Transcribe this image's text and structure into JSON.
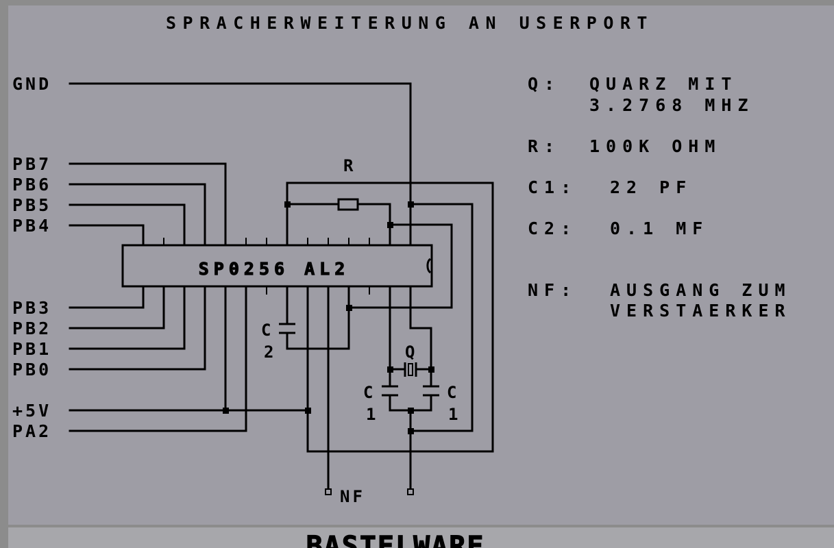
{
  "title": "SPRACHERWEITERUNG AN USERPORT",
  "chip_label": "SP0256 AL2",
  "pins_left": [
    "GND",
    "PB7",
    "PB6",
    "PB5",
    "PB4",
    "PB3",
    "PB2",
    "PB1",
    "PB0",
    "+5V",
    "PA2"
  ],
  "component_labels": {
    "resistor": "R",
    "cap_c2_letter": "C",
    "cap_c2_digit": "2",
    "crystal": "Q",
    "cap_c1_left_letter": "C",
    "cap_c1_left_digit": "1",
    "cap_c1_right_letter": "C",
    "cap_c1_right_digit": "1",
    "output": "NF"
  },
  "legend": {
    "q_key": "Q:",
    "q_line1": "QUARZ MIT",
    "q_line2": "3.2768 MHZ",
    "r_key": "R:",
    "r_value": "100K OHM",
    "c1_key": "C1:",
    "c1_value": "22 PF",
    "c2_key": "C2:",
    "c2_value": "0.1 MF",
    "nf_key": "NF:",
    "nf_line1": "AUSGANG ZUM",
    "nf_line2": "VERSTAERKER"
  },
  "footer": "BASTELWARE",
  "colors": {
    "background": "#9e9da5",
    "border": "#8c8c8c",
    "ink": "#000000",
    "footer_bg": "#a7a7ab"
  }
}
